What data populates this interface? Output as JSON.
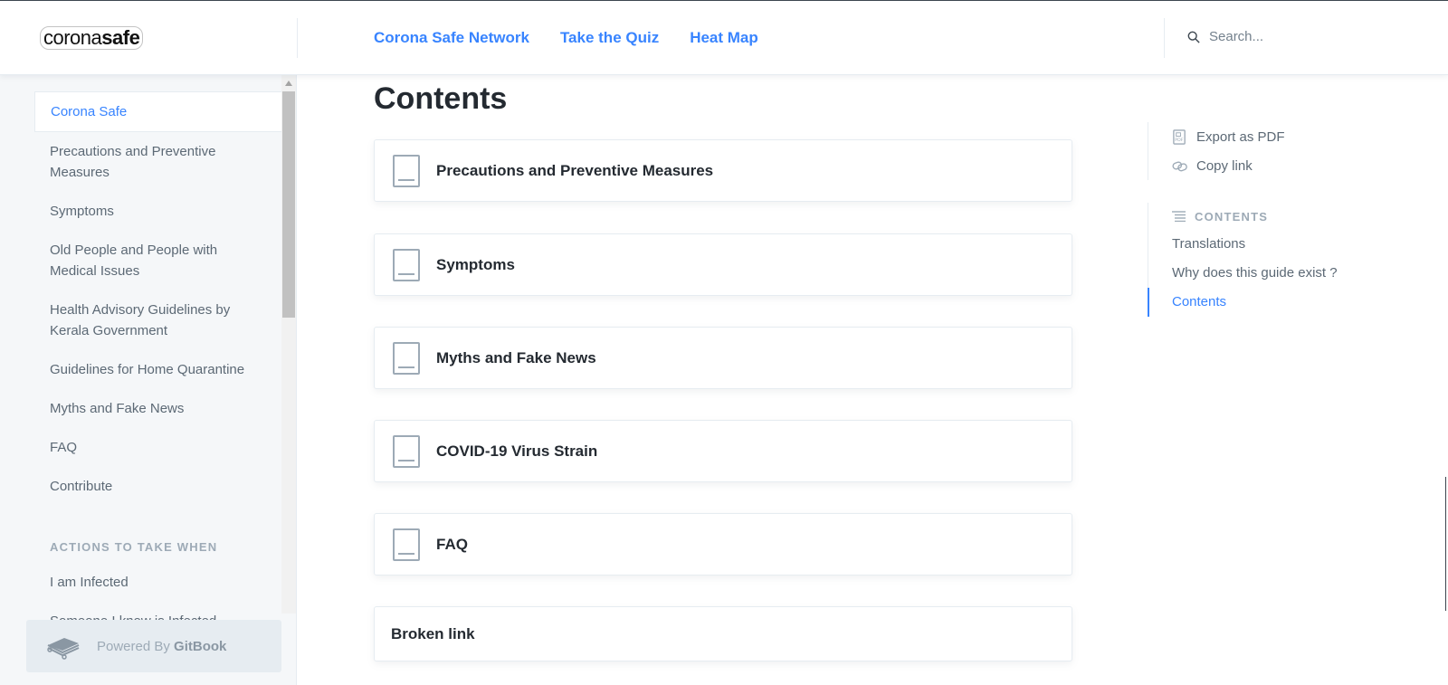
{
  "header": {
    "logo_light": "corona",
    "logo_bold": "safe",
    "nav": [
      "Corona Safe Network",
      "Take the Quiz",
      "Heat Map"
    ],
    "search_placeholder": "Search..."
  },
  "sidebar": {
    "items": [
      {
        "label": "Corona Safe",
        "active": true
      },
      {
        "label": "Precautions and Preventive Measures"
      },
      {
        "label": "Symptoms"
      },
      {
        "label": "Old People and People with Medical Issues"
      },
      {
        "label": "Health Advisory Guidelines by Kerala Government"
      },
      {
        "label": "Guidelines for Home Quarantine"
      },
      {
        "label": "Myths and Fake News"
      },
      {
        "label": "FAQ"
      },
      {
        "label": "Contribute"
      }
    ],
    "section_title": "ACTIONS TO TAKE WHEN",
    "section_items": [
      {
        "label": "I am Infected"
      },
      {
        "label": "Someone I know is Infected"
      }
    ],
    "powered_prefix": "Powered By",
    "powered_brand": "GitBook"
  },
  "main": {
    "title": "Contents",
    "cards": [
      {
        "label": "Precautions and Preventive Measures"
      },
      {
        "label": "Symptoms"
      },
      {
        "label": "Myths and Fake News"
      },
      {
        "label": "COVID-19 Virus Strain"
      },
      {
        "label": "FAQ"
      }
    ],
    "broken_link": "Broken link"
  },
  "right": {
    "actions": [
      {
        "label": "Export as PDF",
        "icon": "pdf-icon"
      },
      {
        "label": "Copy link",
        "icon": "link-icon"
      }
    ],
    "toc_title": "CONTENTS",
    "toc_items": [
      {
        "label": "Translations"
      },
      {
        "label": "Why does this guide exist ?"
      },
      {
        "label": "Contents",
        "active": true
      }
    ]
  },
  "colors": {
    "accent": "#3884ff",
    "sidebar_bg": "#f5f7f9",
    "text": "#242a31",
    "muted": "#5c6975"
  }
}
